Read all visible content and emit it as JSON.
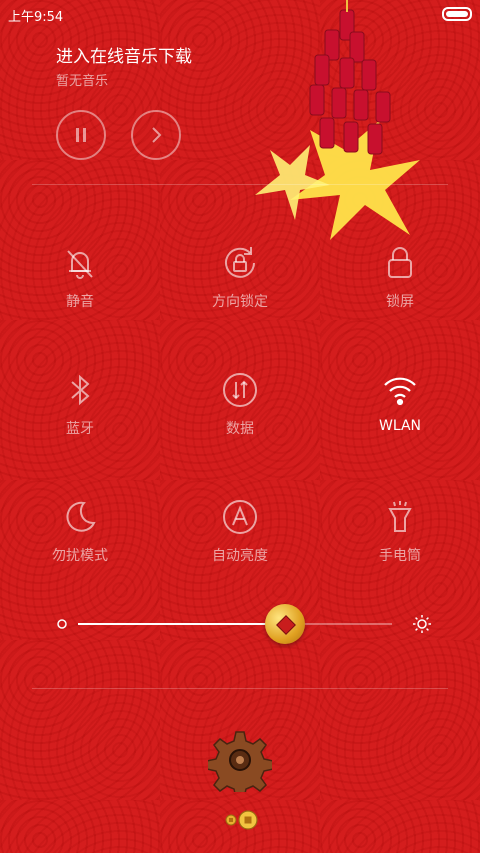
{
  "status_bar": {
    "time": "上午9:54"
  },
  "music": {
    "title": "进入在线音乐下载",
    "subtitle": "暂无音乐"
  },
  "toggles": [
    {
      "label": "静音",
      "icon": "bell-off-icon",
      "active": false
    },
    {
      "label": "方向锁定",
      "icon": "rotation-lock-icon",
      "active": false
    },
    {
      "label": "锁屏",
      "icon": "lock-icon",
      "active": false
    },
    {
      "label": "蓝牙",
      "icon": "bluetooth-icon",
      "active": false
    },
    {
      "label": "数据",
      "icon": "mobile-data-icon",
      "active": false
    },
    {
      "label": "WLAN",
      "icon": "wifi-icon",
      "active": true
    },
    {
      "label": "勿扰模式",
      "icon": "moon-icon",
      "active": false
    },
    {
      "label": "自动亮度",
      "icon": "auto-brightness-icon",
      "active": false
    },
    {
      "label": "手电筒",
      "icon": "flashlight-icon",
      "active": false
    }
  ],
  "brightness": {
    "level": 0.66
  },
  "colors": {
    "background": "#d41d1d",
    "active_label": "#ffffff",
    "inactive_label": "#f0a0a0"
  }
}
